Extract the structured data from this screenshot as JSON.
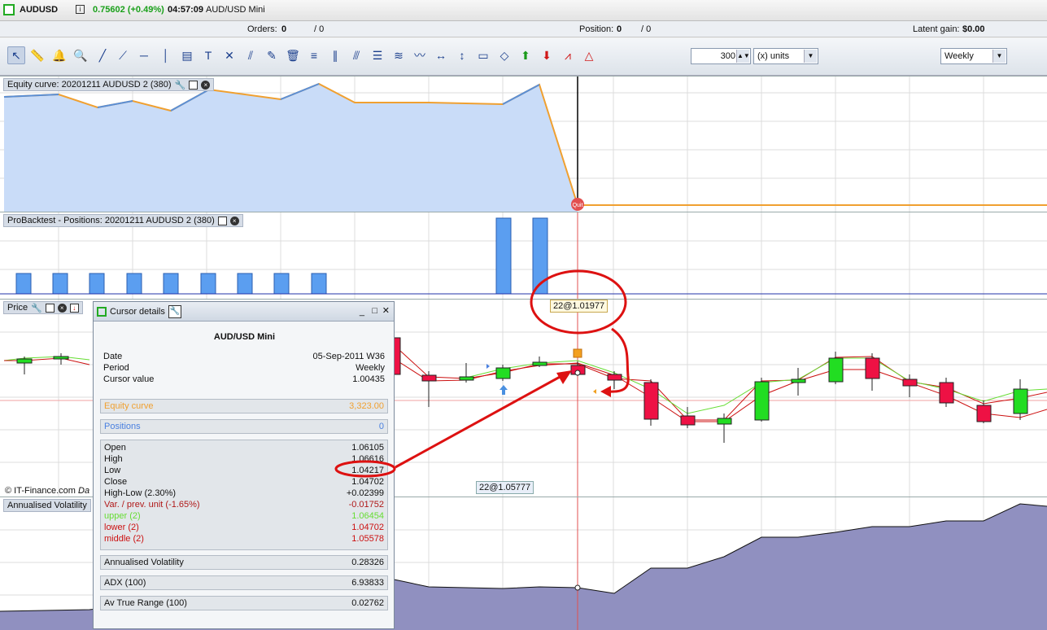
{
  "titlebar": {
    "symbol": "AUDUSD",
    "price": "0.75602 (+0.49%)",
    "time": "04:57:09",
    "instrument": "AUD/USD Mini"
  },
  "ordersbar": {
    "orders_label": "Orders:",
    "orders_value": "0",
    "orders_total": "/ 0",
    "position_label": "Position:",
    "position_value": "0",
    "position_total": "/ 0",
    "latent_label": "Latent gain:",
    "latent_value": "$0.00"
  },
  "toolbar": {
    "units_value": "300",
    "units_type": "(x) units",
    "period": "Weekly"
  },
  "panes": {
    "equity_label": "Equity curve: 20201211 AUDUSD 2 (380)",
    "positions_label": "ProBacktest - Positions: 20201211 AUDUSD 2 (380)",
    "price_label": "Price",
    "volatility_label": "Annualised Volatility",
    "copyright": "© IT-Finance.com",
    "copyright_tail": "Da",
    "quit_badge": "Quit",
    "cursor_tag_top": "22@1.01977",
    "cursor_tag_bottom": "22@1.05777"
  },
  "cursor_details": {
    "title": "Cursor details",
    "instrument": "AUD/USD Mini",
    "date_label": "Date",
    "date_value": "05-Sep-2011 W36",
    "period_label": "Period",
    "period_value": "Weekly",
    "cursor_label": "Cursor value",
    "cursor_value": "1.00435",
    "equity_label": "Equity curve",
    "equity_value": "3,323.00",
    "positions_label": "Positions",
    "positions_value": "0",
    "ohlc": [
      {
        "label": "Open",
        "value": "1.06105",
        "color": "#111111"
      },
      {
        "label": "High",
        "value": "1.06616",
        "color": "#111111"
      },
      {
        "label": "Low",
        "value": "1.04217",
        "color": "#111111"
      },
      {
        "label": "Close",
        "value": "1.04702",
        "color": "#111111"
      },
      {
        "label": "High-Low (2.30%)",
        "value": "+0.02399",
        "color": "#111111"
      },
      {
        "label": "Var. / prev. unit (-1.65%)",
        "value": "-0.01752",
        "color": "#b01818"
      },
      {
        "label": "upper (2)",
        "value": "1.06454",
        "color": "#66dd33"
      },
      {
        "label": "lower (2)",
        "value": "1.04702",
        "color": "#cc1111"
      },
      {
        "label": "middle (2)",
        "value": "1.05578",
        "color": "#cc1111"
      }
    ],
    "annualised_label": "Annualised Volatility",
    "annualised_value": "0.28326",
    "adx_label": "ADX (100)",
    "adx_value": "6.93833",
    "atr_label": "Av True Range (100)",
    "atr_value": "0.02762"
  },
  "colors": {
    "equity_fill": "#c9dcf8",
    "equity_line_up": "#5b8fd6",
    "equity_line_down": "#f0a030",
    "bar_up": "#22dd22",
    "bar_down": "#ee1144",
    "volatility_fill": "#9090c0",
    "annotation": "#dd1111",
    "position_bar": "#5b9ef0"
  },
  "icons": [
    "cursor-icon",
    "ruler-icon",
    "bell-icon",
    "zoom-icon",
    "line-icon",
    "ray-icon",
    "hline-icon",
    "vline-icon",
    "channel-icon",
    "text-icon",
    "cross-icon",
    "pencil-icon",
    "trash-icon",
    "arrow-up-icon",
    "arrow-down-icon"
  ]
}
